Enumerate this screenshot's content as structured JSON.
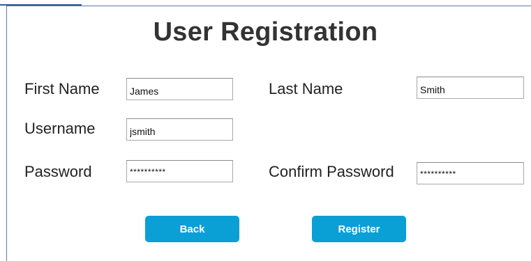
{
  "form": {
    "title": "User Registration",
    "first_name": {
      "label": "First Name",
      "value": "James"
    },
    "last_name": {
      "label": "Last Name",
      "value": "Smith"
    },
    "username": {
      "label": "Username",
      "value": "jsmith"
    },
    "password": {
      "label": "Password",
      "value": "**********"
    },
    "confirm_password": {
      "label": "Confirm Password",
      "value": "**********"
    }
  },
  "buttons": {
    "back_label": "Back",
    "register_label": "Register"
  },
  "colors": {
    "button_bg": "#0aa0d6",
    "panel_border": "#5b7ca8",
    "title_text": "#333333"
  }
}
